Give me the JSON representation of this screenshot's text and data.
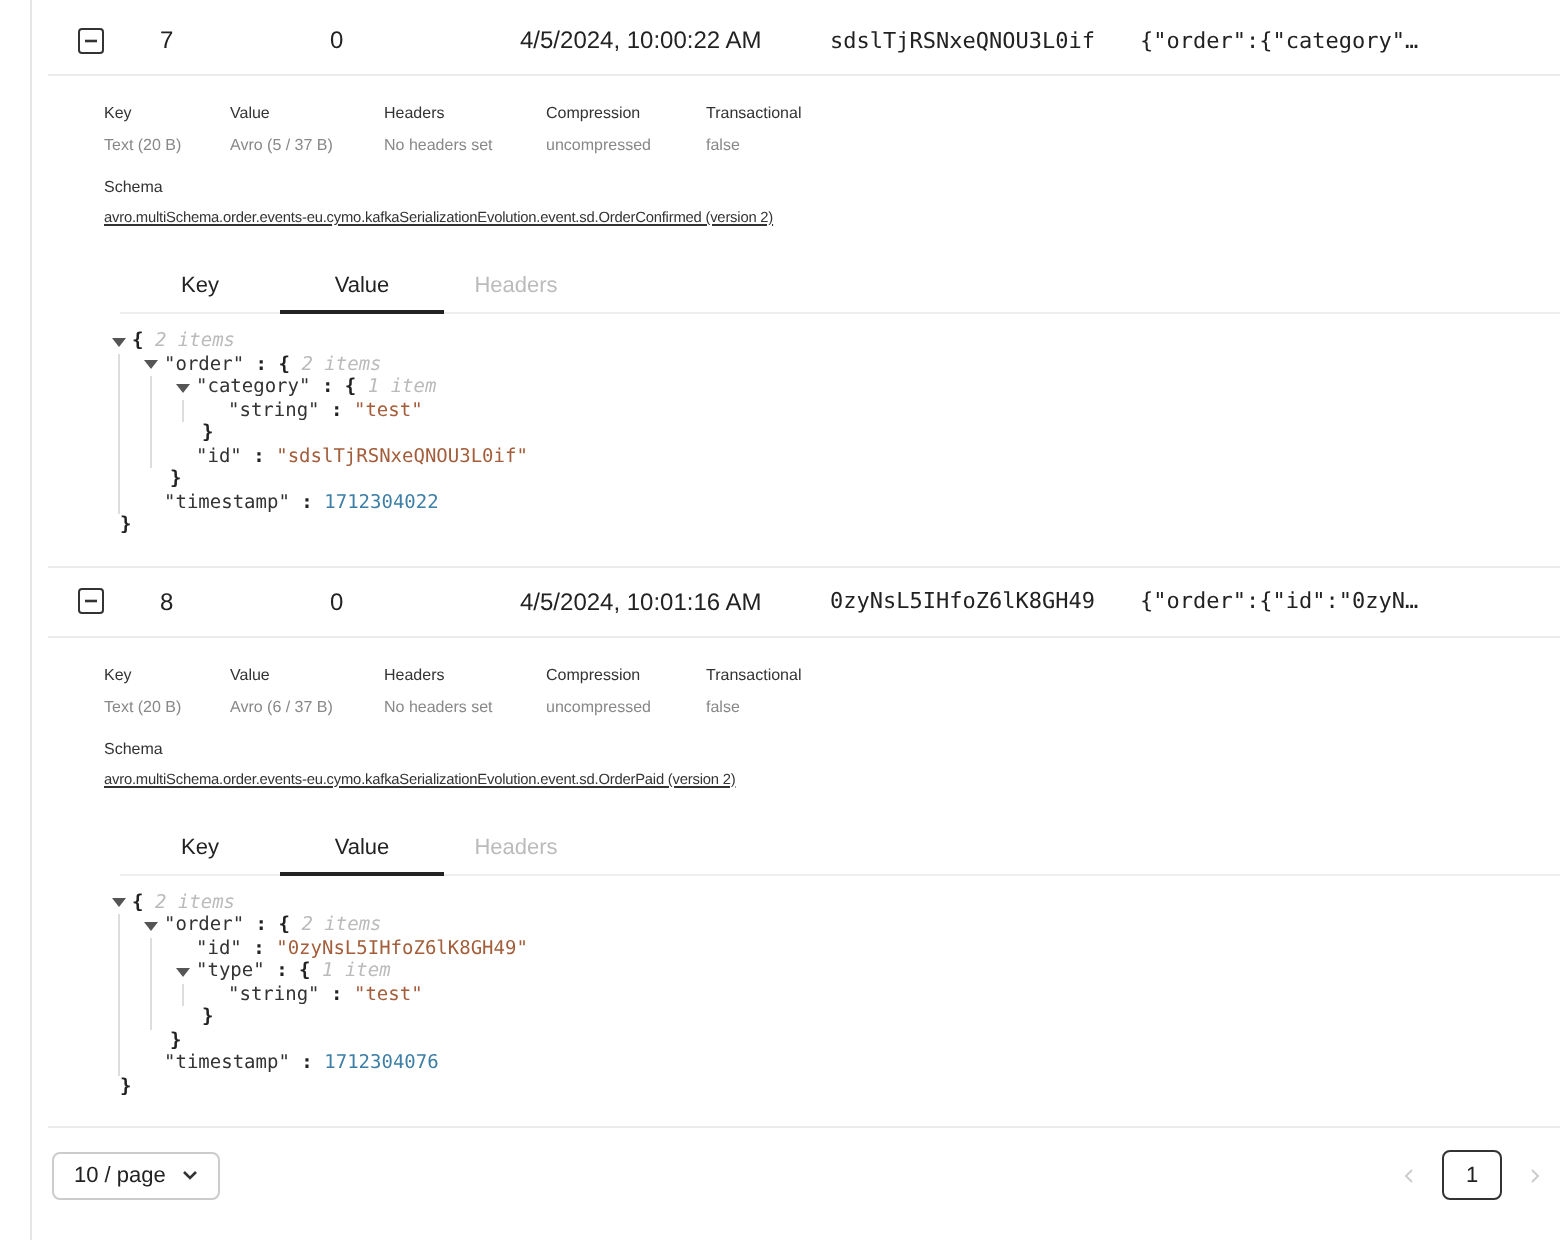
{
  "messages": [
    {
      "expanded": true,
      "cells": [
        "7",
        "0",
        "4/5/2024, 10:00:22 AM",
        "sdslTjRSNxeQNOU3L0if",
        "{\"order\":{\"category\"…"
      ],
      "meta": [
        {
          "label": "Key",
          "value": "Text (20 B)"
        },
        {
          "label": "Value",
          "value": "Avro (5 / 37 B)"
        },
        {
          "label": "Headers",
          "value": "No headers set"
        },
        {
          "label": "Compression",
          "value": "uncompressed"
        },
        {
          "label": "Transactional",
          "value": "false"
        }
      ],
      "schema_label": "Schema",
      "schema_link": "avro.multiSchema.order.events-eu.cymo.kafkaSerializationEvolution.event.sd.OrderConfirmed (version 2)",
      "tabs": [
        {
          "label": "Key",
          "selected": false,
          "disabled": false
        },
        {
          "label": "Value",
          "selected": true,
          "disabled": false
        },
        {
          "label": "Headers",
          "selected": false,
          "disabled": true
        }
      ],
      "tree": {
        "kind": "object",
        "open": "{",
        "count": "2 items",
        "expanded": true,
        "close": "}",
        "children": [
          {
            "kind": "object",
            "key": "\"order\"",
            "sep": ":",
            "open": "{",
            "count": "2 items",
            "expanded": true,
            "close": "}",
            "children": [
              {
                "kind": "object",
                "key": "\"category\"",
                "sep": ":",
                "open": "{",
                "count": "1 item",
                "expanded": true,
                "close": "}",
                "children": [
                  {
                    "kind": "string",
                    "key": "\"string\"",
                    "sep": ":",
                    "value": "\"test\""
                  }
                ]
              },
              {
                "kind": "string",
                "key": "\"id\"",
                "sep": ":",
                "value": "\"sdslTjRSNxeQNOU3L0if\""
              }
            ]
          },
          {
            "kind": "number",
            "key": "\"timestamp\"",
            "sep": ":",
            "value": "1712304022"
          }
        ]
      }
    },
    {
      "expanded": true,
      "cells": [
        "8",
        "0",
        "4/5/2024, 10:01:16 AM",
        "0zyNsL5IHfoZ6lK8GH49",
        "{\"order\":{\"id\":\"0zyN…"
      ],
      "meta": [
        {
          "label": "Key",
          "value": "Text (20 B)"
        },
        {
          "label": "Value",
          "value": "Avro (6 / 37 B)"
        },
        {
          "label": "Headers",
          "value": "No headers set"
        },
        {
          "label": "Compression",
          "value": "uncompressed"
        },
        {
          "label": "Transactional",
          "value": "false"
        }
      ],
      "schema_label": "Schema",
      "schema_link": "avro.multiSchema.order.events-eu.cymo.kafkaSerializationEvolution.event.sd.OrderPaid (version 2)",
      "tabs": [
        {
          "label": "Key",
          "selected": false,
          "disabled": false
        },
        {
          "label": "Value",
          "selected": true,
          "disabled": false
        },
        {
          "label": "Headers",
          "selected": false,
          "disabled": true
        }
      ],
      "tree": {
        "kind": "object",
        "open": "{",
        "count": "2 items",
        "expanded": true,
        "close": "}",
        "children": [
          {
            "kind": "object",
            "key": "\"order\"",
            "sep": ":",
            "open": "{",
            "count": "2 items",
            "expanded": true,
            "close": "}",
            "children": [
              {
                "kind": "string",
                "key": "\"id\"",
                "sep": ":",
                "value": "\"0zyNsL5IHfoZ6lK8GH49\""
              },
              {
                "kind": "object",
                "key": "\"type\"",
                "sep": ":",
                "open": "{",
                "count": "1 item",
                "expanded": true,
                "close": "}",
                "children": [
                  {
                    "kind": "string",
                    "key": "\"string\"",
                    "sep": ":",
                    "value": "\"test\""
                  }
                ]
              }
            ]
          },
          {
            "kind": "number",
            "key": "\"timestamp\"",
            "sep": ":",
            "value": "1712304076"
          }
        ]
      }
    }
  ],
  "pagination": {
    "page_size": "10 / page",
    "prev_disabled": true,
    "next_disabled": true,
    "pages": [
      {
        "label": "1",
        "selected": true
      }
    ]
  }
}
